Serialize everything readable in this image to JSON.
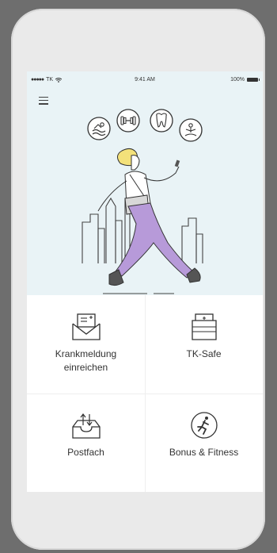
{
  "status_bar": {
    "carrier": "TK",
    "time": "9:41 AM",
    "battery": "100%"
  },
  "menu": {
    "icon": "hamburger-menu-icon"
  },
  "hero_icons": [
    "swimming-icon",
    "dumbbell-icon",
    "tooth-icon",
    "meditation-icon"
  ],
  "tiles": [
    {
      "label": "Krankmeldung\neinreichen",
      "icon": "envelope-report-icon"
    },
    {
      "label": "TK-Safe",
      "icon": "folder-safe-icon"
    },
    {
      "label": "Postfach",
      "icon": "inbox-icon"
    },
    {
      "label": "Bonus & Fitness",
      "icon": "running-icon"
    }
  ],
  "colors": {
    "hero_bg": "#e9f3f6",
    "accent_purple": "#b79ad9",
    "line": "#333333"
  }
}
